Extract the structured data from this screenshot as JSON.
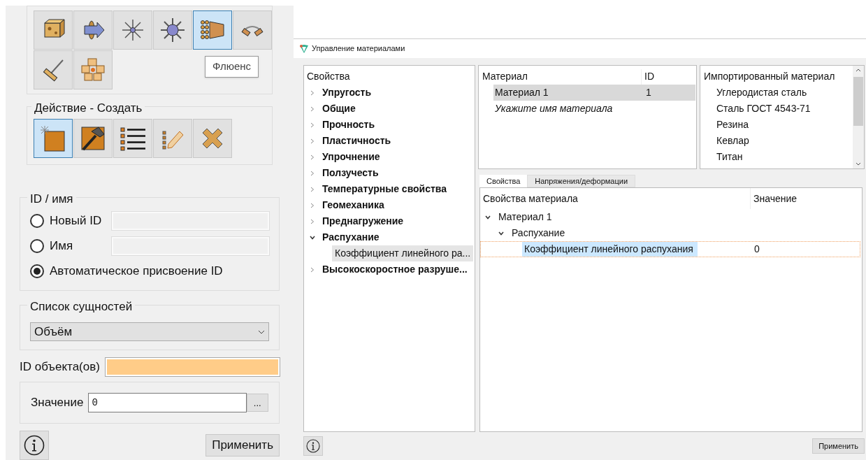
{
  "left_panel": {
    "type_buttons": [
      {
        "selected": false
      },
      {
        "selected": false
      },
      {
        "selected": false
      },
      {
        "selected": false
      },
      {
        "selected": true
      },
      {
        "selected": false
      },
      {
        "selected": false
      },
      {
        "selected": false
      }
    ],
    "tooltip": "Флюенс",
    "action_group": {
      "title": "Действие - Создать",
      "buttons": [
        {
          "selected": true
        },
        {
          "selected": false
        },
        {
          "selected": false
        },
        {
          "selected": false
        },
        {
          "selected": false
        }
      ]
    },
    "id_group": {
      "title": "ID / имя",
      "options": [
        {
          "label": "Новый ID",
          "selected": false,
          "kind": "field"
        },
        {
          "label": "Имя",
          "selected": false,
          "kind": "field"
        },
        {
          "label": "Автоматическое присвоение ID",
          "selected": true,
          "kind": "plain"
        }
      ]
    },
    "entity_list": {
      "title": "Список сущностей",
      "value": "Объём"
    },
    "object_id": {
      "label": "ID объекта(ов)"
    },
    "value_row": {
      "label": "Значение",
      "value": "0",
      "browse": "..."
    },
    "apply": "Применить"
  },
  "material_window": {
    "title": "Управление материалами",
    "tree": {
      "header": "Свойства",
      "items": [
        {
          "label": "Упругость",
          "expanded": false
        },
        {
          "label": "Общие",
          "expanded": false
        },
        {
          "label": "Прочность",
          "expanded": false
        },
        {
          "label": "Пластичность",
          "expanded": false
        },
        {
          "label": "Упрочнение",
          "expanded": false
        },
        {
          "label": "Ползучесть",
          "expanded": false
        },
        {
          "label": "Температурные свойства",
          "expanded": false
        },
        {
          "label": "Геомеханика",
          "expanded": false
        },
        {
          "label": "Преднагружение",
          "expanded": false
        },
        {
          "label": "Распухание",
          "expanded": true,
          "children": [
            {
              "label": "Коэффициент линейного ра...",
              "selected": true
            }
          ]
        },
        {
          "label": "Высокоскоростное разруше...",
          "expanded": false
        }
      ]
    },
    "materials": {
      "columns": [
        "Материал",
        "ID"
      ],
      "rows": [
        {
          "name": "Материал 1",
          "id": "1",
          "selected": true,
          "kind": "item"
        },
        {
          "name": "Укажите имя материала",
          "selected": false,
          "kind": "prompt"
        }
      ]
    },
    "imported": {
      "header": "Импортированный материал",
      "items": [
        "Углеродистая сталь",
        "Сталь ГОСТ 4543-71",
        "Резина",
        "Кевлар",
        "Титан"
      ]
    },
    "tabs": [
      {
        "label": "Свойства",
        "selected": true
      },
      {
        "label": "Напряжения/деформации",
        "selected": false
      }
    ],
    "properties": {
      "columns": [
        "Свойства материала",
        "Значение"
      ],
      "rows": [
        {
          "label": "Материал 1",
          "expanded": true,
          "children": [
            {
              "label": "Распухание",
              "expanded": true,
              "children": [
                {
                  "label": "Коэффициент линейного распухания",
                  "value": "0",
                  "selected": true
                }
              ]
            }
          ]
        }
      ]
    },
    "apply": "Применить"
  }
}
